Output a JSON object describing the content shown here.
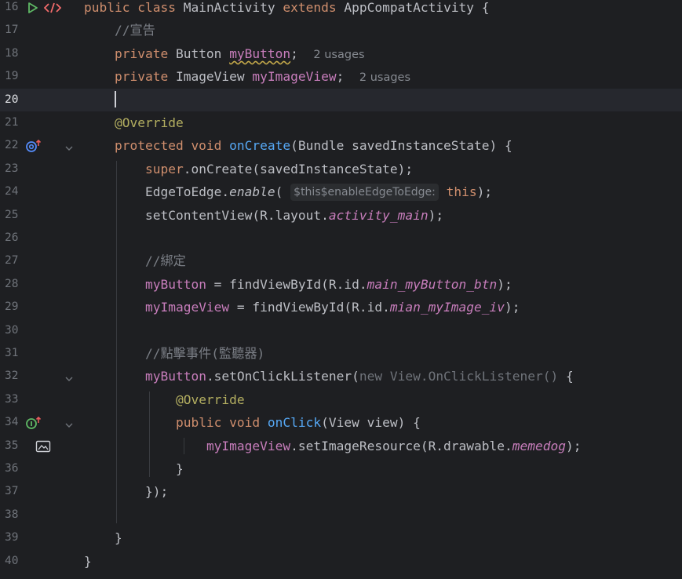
{
  "lines": [
    {
      "num": "16",
      "tokens": [
        {
          "t": "public class ",
          "c": "kw"
        },
        {
          "t": "MainActivity "
        },
        {
          "t": "extends ",
          "c": "kw"
        },
        {
          "t": "AppCompatActivity {"
        }
      ]
    },
    {
      "num": "17",
      "tokens": [
        {
          "t": "    "
        },
        {
          "t": "//宣告",
          "c": "cmt"
        }
      ]
    },
    {
      "num": "18",
      "tokens": [
        {
          "t": "    "
        },
        {
          "t": "private ",
          "c": "kw"
        },
        {
          "t": "Button "
        },
        {
          "t": "myButton",
          "c": "fld warn"
        },
        {
          "t": ";  "
        },
        {
          "t": "2 usages",
          "c": "hint"
        }
      ]
    },
    {
      "num": "19",
      "tokens": [
        {
          "t": "    "
        },
        {
          "t": "private ",
          "c": "kw"
        },
        {
          "t": "ImageView "
        },
        {
          "t": "myImageView",
          "c": "fld"
        },
        {
          "t": ";  "
        },
        {
          "t": "2 usages",
          "c": "hint"
        }
      ]
    },
    {
      "num": "20",
      "tokens": [
        {
          "t": "    "
        },
        {
          "t": "",
          "c": "caret"
        }
      ]
    },
    {
      "num": "21",
      "tokens": [
        {
          "t": "    "
        },
        {
          "t": "@Override",
          "c": "ann"
        }
      ]
    },
    {
      "num": "22",
      "tokens": [
        {
          "t": "    "
        },
        {
          "t": "protected void ",
          "c": "kw"
        },
        {
          "t": "onCreate",
          "c": "fn"
        },
        {
          "t": "(Bundle savedInstanceState) {"
        }
      ]
    },
    {
      "num": "23",
      "tokens": [
        {
          "t": "        "
        },
        {
          "t": "super",
          "c": "kw"
        },
        {
          "t": ".onCreate(savedInstanceState);"
        }
      ]
    },
    {
      "num": "24",
      "tokens": [
        {
          "t": "        "
        },
        {
          "t": "EdgeToEdge."
        },
        {
          "t": "enable",
          "c": "itf"
        },
        {
          "t": "( "
        },
        {
          "t": "$this$enableEdgeToEdge:",
          "c": "inlay"
        },
        {
          "t": " "
        },
        {
          "t": "this",
          "c": "kw"
        },
        {
          "t": ");"
        }
      ]
    },
    {
      "num": "25",
      "tokens": [
        {
          "t": "        "
        },
        {
          "t": "setContentView(R.layout."
        },
        {
          "t": "activity_main",
          "c": "ital"
        },
        {
          "t": ");"
        }
      ]
    },
    {
      "num": "26",
      "tokens": [
        {
          "t": ""
        }
      ]
    },
    {
      "num": "27",
      "tokens": [
        {
          "t": "        "
        },
        {
          "t": "//綁定",
          "c": "cmt"
        }
      ]
    },
    {
      "num": "28",
      "tokens": [
        {
          "t": "        "
        },
        {
          "t": "myButton",
          "c": "fld"
        },
        {
          "t": " = findViewById(R.id."
        },
        {
          "t": "main_myButton_btn",
          "c": "ital"
        },
        {
          "t": ");"
        }
      ]
    },
    {
      "num": "29",
      "tokens": [
        {
          "t": "        "
        },
        {
          "t": "myImageView",
          "c": "fld"
        },
        {
          "t": " = findViewById(R.id."
        },
        {
          "t": "mian_myImage_iv",
          "c": "ital"
        },
        {
          "t": ");"
        }
      ]
    },
    {
      "num": "30",
      "tokens": [
        {
          "t": ""
        }
      ]
    },
    {
      "num": "31",
      "tokens": [
        {
          "t": "        "
        },
        {
          "t": "//點擊事件(監聽器)",
          "c": "cmt"
        }
      ]
    },
    {
      "num": "32",
      "tokens": [
        {
          "t": "        "
        },
        {
          "t": "myButton",
          "c": "fld"
        },
        {
          "t": ".setOnClickListener("
        },
        {
          "t": "new View.OnClickListener() ",
          "c": "dim"
        },
        {
          "t": "{"
        }
      ]
    },
    {
      "num": "33",
      "tokens": [
        {
          "t": "            "
        },
        {
          "t": "@Override",
          "c": "ann"
        }
      ]
    },
    {
      "num": "34",
      "tokens": [
        {
          "t": "            "
        },
        {
          "t": "public void ",
          "c": "kw"
        },
        {
          "t": "onClick",
          "c": "fn"
        },
        {
          "t": "(View view) {"
        }
      ]
    },
    {
      "num": "35",
      "tokens": [
        {
          "t": "                "
        },
        {
          "t": "myImageView",
          "c": "fld"
        },
        {
          "t": ".setImageResource(R.drawable."
        },
        {
          "t": "memedog",
          "c": "ital"
        },
        {
          "t": ");"
        }
      ]
    },
    {
      "num": "36",
      "tokens": [
        {
          "t": "            }"
        }
      ]
    },
    {
      "num": "37",
      "tokens": [
        {
          "t": "        });"
        }
      ]
    },
    {
      "num": "38",
      "tokens": [
        {
          "t": ""
        }
      ]
    },
    {
      "num": "39",
      "tokens": [
        {
          "t": "    }"
        }
      ]
    },
    {
      "num": "40",
      "tokens": [
        {
          "t": "}"
        }
      ]
    }
  ],
  "current_line": "20",
  "gutter_icons": [
    {
      "line": "16",
      "icons": [
        "run-icon",
        "code-icon"
      ]
    },
    {
      "line": "22",
      "icons": [
        "override-method-icon",
        "fold-chevron-icon"
      ]
    },
    {
      "line": "32",
      "icons": [
        "fold-chevron-icon"
      ]
    },
    {
      "line": "34",
      "icons": [
        "implement-method-icon",
        "fold-chevron-icon"
      ]
    },
    {
      "line": "35",
      "icons": [
        "image-resource-icon"
      ]
    }
  ],
  "colors": {
    "background": "#1e1f22",
    "keyword": "#cf8e6d",
    "field": "#c77dbb",
    "method": "#56a8f5",
    "annotation": "#b3ae60",
    "comment": "#7a7e85",
    "text": "#bcbec4",
    "run_green": "#5fb865"
  }
}
